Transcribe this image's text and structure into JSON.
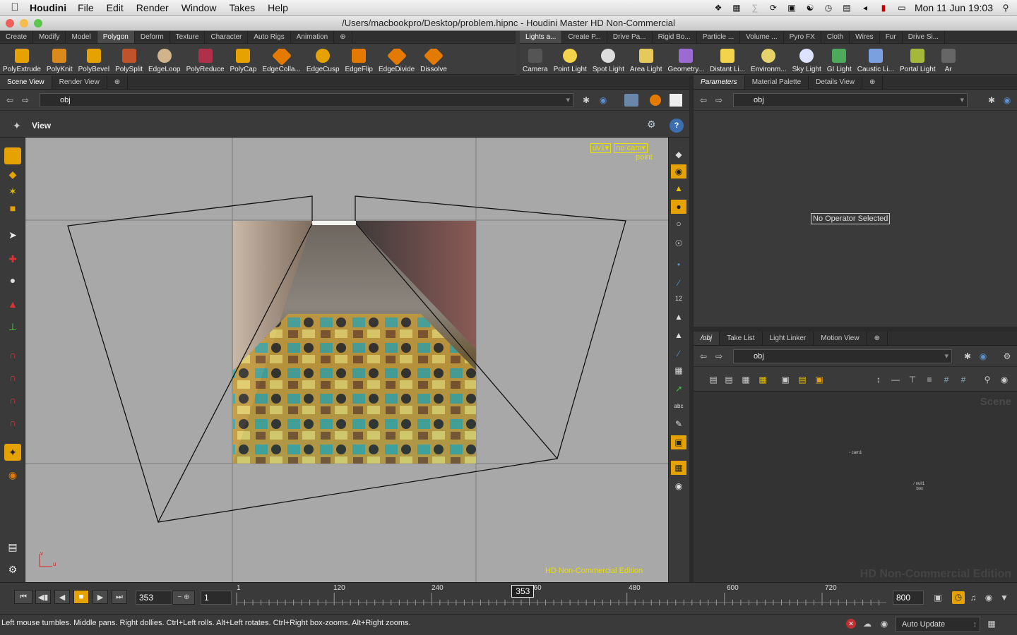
{
  "menubar": {
    "app": "Houdini",
    "menus": [
      "File",
      "Edit",
      "Render",
      "Window",
      "Takes",
      "Help"
    ],
    "clock": "Mon 11 Jun  19:03"
  },
  "window": {
    "title": "/Users/macbookpro/Desktop/problem.hipnc - Houdini Master HD Non-Commercial"
  },
  "shelf_left": {
    "tabs": [
      "Create",
      "Modify",
      "Model",
      "Polygon",
      "Deform",
      "Texture",
      "Character",
      "Auto Rigs",
      "Animation"
    ],
    "active_tab": "Polygon",
    "tools": [
      "PolyExtrude",
      "PolyKnit",
      "PolyBevel",
      "PolySplit",
      "EdgeLoop",
      "PolyReduce",
      "PolyCap",
      "EdgeColla...",
      "EdgeCusp",
      "EdgeFlip",
      "EdgeDivide",
      "Dissolve"
    ]
  },
  "shelf_right": {
    "tabs": [
      "Lights a...",
      "Create P...",
      "Drive Pa...",
      "Rigid Bo...",
      "Particle ...",
      "Volume ...",
      "Pyro FX",
      "Cloth",
      "Wires",
      "Fur",
      "Drive Si..."
    ],
    "tools": [
      "Camera",
      "Point Light",
      "Spot Light",
      "Area Light",
      "Geometry...",
      "Distant Li...",
      "Environm...",
      "Sky Light",
      "GI Light",
      "Caustic Li...",
      "Portal Light",
      "Ar"
    ]
  },
  "scene_panel": {
    "tabs": [
      "Scene View",
      "Render View"
    ],
    "path": "obj",
    "view_label": "View",
    "uv_menu": "uv1",
    "cam_menu": "no cam",
    "select_mode": "point",
    "watermark": "HD Non-Commercial Edition"
  },
  "param_panel": {
    "tabs": [
      "Parameters",
      "Material Palette",
      "Details View"
    ],
    "path": "obj",
    "message": "No Operator Selected"
  },
  "network_panel": {
    "tabs": [
      "/obj",
      "Take List",
      "Light Linker",
      "Motion View"
    ],
    "path": "obj",
    "scene_label": "Scene",
    "watermark": "HD Non-Commercial Edition",
    "nodes": [
      "cam1",
      "null1",
      "box"
    ]
  },
  "timeline": {
    "current_frame": "353",
    "step": "1",
    "end_frame": "800",
    "ticks": [
      "1",
      "120",
      "240",
      "360",
      "480",
      "600",
      "720"
    ],
    "frame_range_start": 1,
    "frame_range_end": 800
  },
  "status": {
    "hint": "Left mouse tumbles. Middle pans. Right dollies. Ctrl+Left rolls. Alt+Left rotates. Ctrl+Right box-zooms. Alt+Right zooms.",
    "update_mode": "Auto Update"
  },
  "colors": {
    "accent": "#e5a200",
    "viewport_bg": "#a8a8a8",
    "guide_yellow": "#e5e000"
  }
}
